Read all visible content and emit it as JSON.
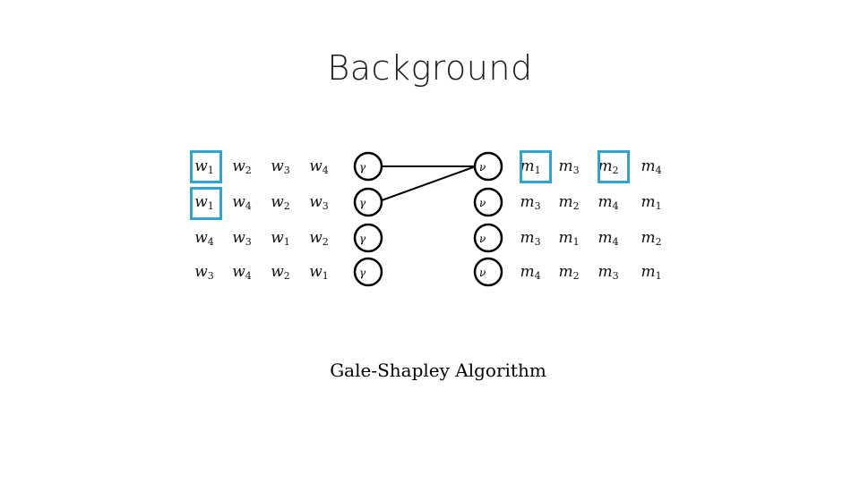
{
  "title": "Background",
  "caption": "Gale-Shapley Algorithm",
  "colors": {
    "highlight": "#2fa2d6",
    "stroke": "#000000"
  },
  "men": {
    "node_glyph": "γ",
    "preferences": [
      [
        {
          "base": "w",
          "sub": "1"
        },
        {
          "base": "w",
          "sub": "2"
        },
        {
          "base": "w",
          "sub": "3"
        },
        {
          "base": "w",
          "sub": "4"
        }
      ],
      [
        {
          "base": "w",
          "sub": "1"
        },
        {
          "base": "w",
          "sub": "4"
        },
        {
          "base": "w",
          "sub": "2"
        },
        {
          "base": "w",
          "sub": "3"
        }
      ],
      [
        {
          "base": "w",
          "sub": "4"
        },
        {
          "base": "w",
          "sub": "3"
        },
        {
          "base": "w",
          "sub": "1"
        },
        {
          "base": "w",
          "sub": "2"
        }
      ],
      [
        {
          "base": "w",
          "sub": "3"
        },
        {
          "base": "w",
          "sub": "4"
        },
        {
          "base": "w",
          "sub": "2"
        },
        {
          "base": "w",
          "sub": "1"
        }
      ]
    ],
    "highlighted": [
      [
        0,
        0
      ],
      [
        1,
        0
      ]
    ]
  },
  "women": {
    "node_glyph": "ν",
    "preferences": [
      [
        {
          "base": "m",
          "sub": "1"
        },
        {
          "base": "m",
          "sub": "3"
        },
        {
          "base": "m",
          "sub": "2"
        },
        {
          "base": "m",
          "sub": "4"
        }
      ],
      [
        {
          "base": "m",
          "sub": "3"
        },
        {
          "base": "m",
          "sub": "2"
        },
        {
          "base": "m",
          "sub": "4"
        },
        {
          "base": "m",
          "sub": "1"
        }
      ],
      [
        {
          "base": "m",
          "sub": "3"
        },
        {
          "base": "m",
          "sub": "1"
        },
        {
          "base": "m",
          "sub": "4"
        },
        {
          "base": "m",
          "sub": "2"
        }
      ],
      [
        {
          "base": "m",
          "sub": "4"
        },
        {
          "base": "m",
          "sub": "2"
        },
        {
          "base": "m",
          "sub": "3"
        },
        {
          "base": "m",
          "sub": "1"
        }
      ]
    ],
    "highlighted": [
      [
        0,
        0
      ],
      [
        0,
        2
      ]
    ]
  },
  "proposals": [
    {
      "from_man": 0,
      "to_woman": 0
    },
    {
      "from_man": 1,
      "to_woman": 0
    }
  ]
}
